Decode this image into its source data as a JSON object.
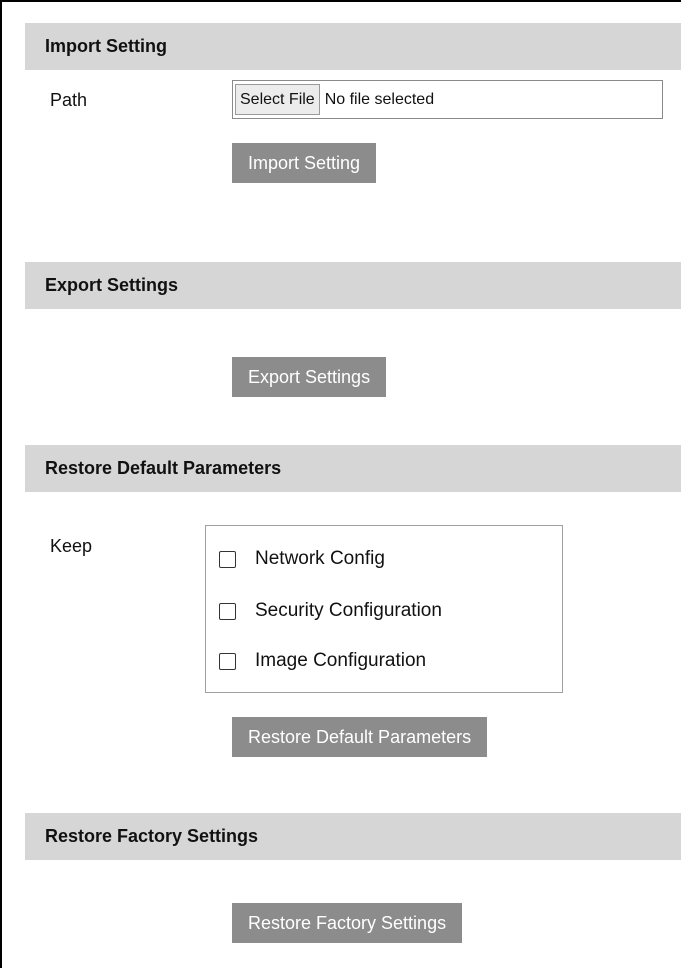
{
  "import": {
    "header": "Import Setting",
    "path_label": "Path",
    "select_file_label": "Select File",
    "file_status": "No file selected",
    "button_label": "Import Setting"
  },
  "export": {
    "header": "Export Settings",
    "button_label": "Export Settings"
  },
  "restore_default": {
    "header": "Restore Default Parameters",
    "keep_label": "Keep",
    "options": [
      {
        "label": "Network Config",
        "checked": false
      },
      {
        "label": "Security Configuration",
        "checked": false
      },
      {
        "label": "Image Configuration",
        "checked": false
      }
    ],
    "button_label": "Restore Default Parameters"
  },
  "restore_factory": {
    "header": "Restore Factory Settings",
    "button_label": "Restore Factory Settings"
  },
  "colors": {
    "header_bg": "#d6d6d6",
    "button_bg": "#8c8c8c",
    "button_text": "#ffffff"
  }
}
